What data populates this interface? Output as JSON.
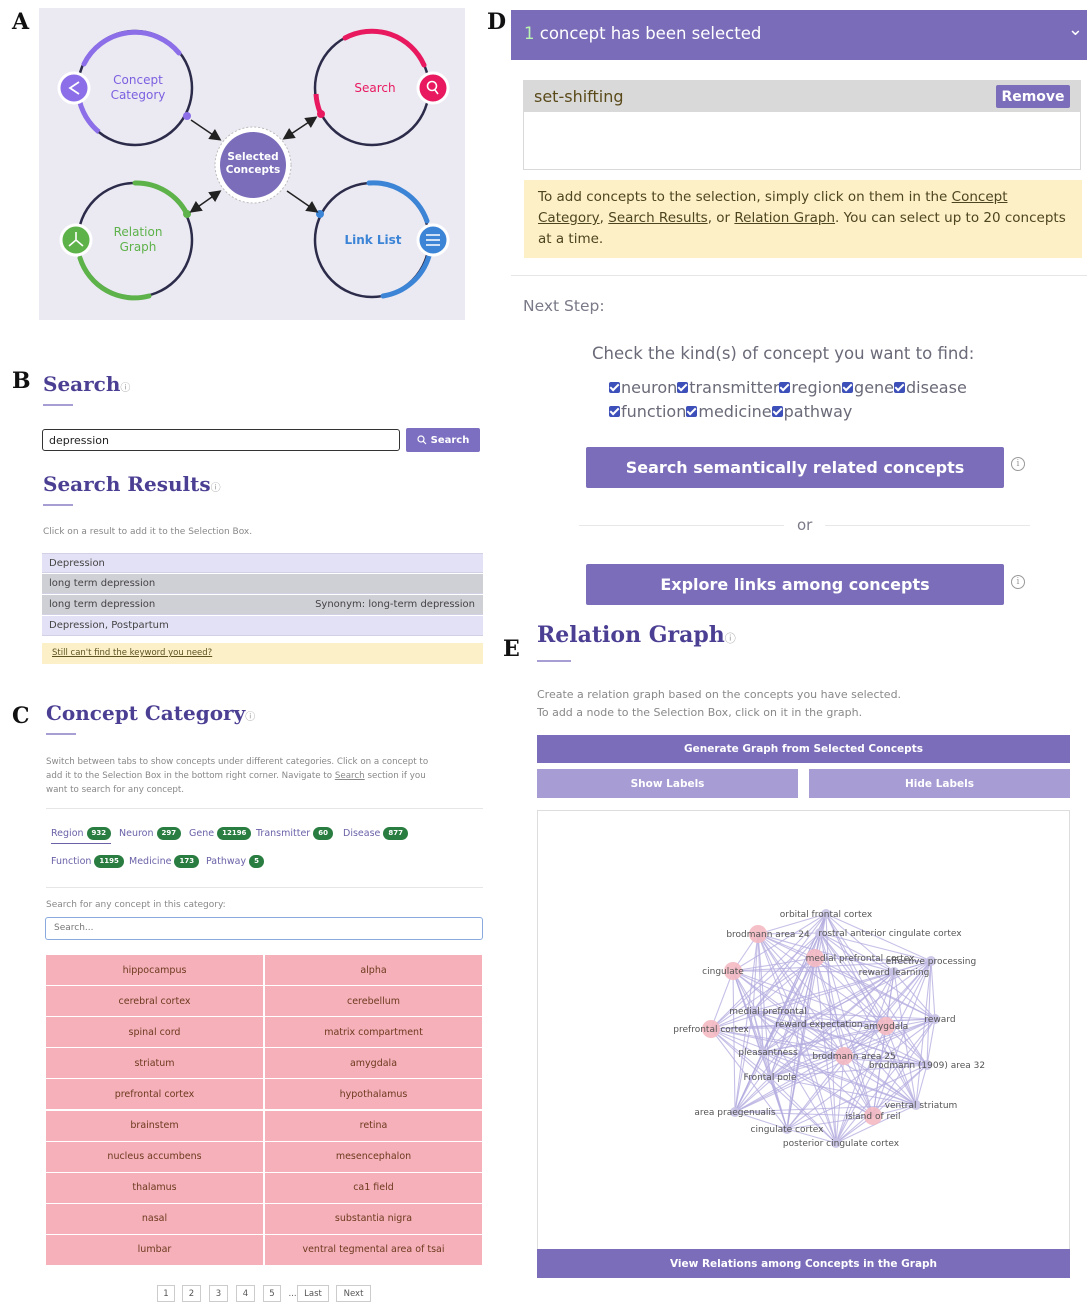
{
  "panel_labels": {
    "a": "A",
    "b": "B",
    "c": "C",
    "d": "D",
    "e": "E"
  },
  "panel_a": {
    "concept_category": "Concept\nCategory",
    "search": "Search",
    "selected_concepts": "Selected\nConcepts",
    "relation_graph": "Relation\nGraph",
    "link_list": "Link List",
    "colors": {
      "purple": "#8b6ee8",
      "red": "#e8195f",
      "green": "#5eb24a",
      "blue": "#3c84d6",
      "dark": "#2c2c4a"
    }
  },
  "panel_b": {
    "title": "Search",
    "info": "ⓘ",
    "search_value": "depression",
    "search_button": "Search",
    "results_title": "Search Results",
    "results_hint": "Click on a result to add it to the Selection Box.",
    "results": [
      {
        "label": "Depression",
        "synonym": "",
        "bg": "#e3e1f5"
      },
      {
        "label": "long term depression",
        "synonym": "",
        "bg": "#cfcfd6"
      },
      {
        "label": "long term depression",
        "synonym": "Synonym: long-term depression",
        "bg": "#cfcfd6"
      },
      {
        "label": "Depression, Postpartum",
        "synonym": "",
        "bg": "#e3e1f5"
      }
    ],
    "not_found": "Still can't find the keyword you need?"
  },
  "panel_c": {
    "title": "Concept Category",
    "info": "ⓘ",
    "desc_line1": "Switch between tabs to show concepts under different categories. Click on a concept to",
    "desc_line2_pre": "add it to the Selection Box in the bottom right corner. Navigate to ",
    "desc_line2_link": "Search",
    "desc_line2_post": " section if you",
    "desc_line3": "want to search for any concept.",
    "tabs_row1": [
      {
        "label": "Region",
        "count": "932"
      },
      {
        "label": "Neuron",
        "count": "297"
      },
      {
        "label": "Gene",
        "count": "12196"
      },
      {
        "label": "Transmitter",
        "count": "60"
      },
      {
        "label": "Disease",
        "count": "877"
      }
    ],
    "tabs_row2": [
      {
        "label": "Function",
        "count": "1195"
      },
      {
        "label": "Medicine",
        "count": "173"
      },
      {
        "label": "Pathway",
        "count": "5"
      }
    ],
    "search_label": "Search for any concept in this category:",
    "search_placeholder": "Search...",
    "grid_left": [
      "hippocampus",
      "cerebral cortex",
      "spinal cord",
      "striatum",
      "prefrontal cortex",
      "brainstem",
      "nucleus accumbens",
      "thalamus",
      "nasal",
      "lumbar"
    ],
    "grid_right": [
      "alpha",
      "cerebellum",
      "matrix compartment",
      "amygdala",
      "hypothalamus",
      "retina",
      "mesencephalon",
      "ca1 field",
      "substantia nigra",
      "ventral tegmental area of tsai"
    ],
    "pages": [
      "1",
      "2",
      "3",
      "4",
      "5",
      "...",
      "Last",
      "Next"
    ]
  },
  "panel_d": {
    "header_count": "1",
    "header_text": " concept has been selected",
    "chevron": "⌄",
    "selected_item": "set-shifting",
    "remove": "Remove",
    "note_1": "To add concepts to the selection, simply click on them in the ",
    "note_link1": "Concept Category",
    "note_2": ", ",
    "note_link2": "Search Results",
    "note_3": ", or ",
    "note_link3": "Relation Graph",
    "note_4": ". You can select up to 20 concepts at a time.",
    "next_step": "Next Step:",
    "check_title": "Check the kind(s) of concept you want to find:",
    "kinds_row1": [
      "neuron",
      "transmitter",
      "region",
      "gene",
      "disease"
    ],
    "kinds_row2": [
      "function",
      "medicine",
      "pathway"
    ],
    "btn_search": "Search semantically related concepts",
    "or": "or",
    "btn_explore": "Explore links among concepts",
    "info": "i"
  },
  "panel_e": {
    "title": "Relation Graph",
    "info": "ⓘ",
    "desc1": "Create a relation graph based on the concepts you have selected.",
    "desc2": "To add a node to the Selection Box, click on it in the graph.",
    "btn_generate": "Generate Graph from Selected Concepts",
    "btn_show": "Show Labels",
    "btn_hide": "Hide Labels",
    "btn_view": "View Relations among Concepts in the Graph",
    "nodes": [
      "orbital frontal cortex",
      "brodmann area 24",
      "rostral anterior cingulate cortex",
      "medial prefrontal cortex",
      "effective processing",
      "cingulate",
      "reward learning",
      "medial prefrontal",
      "reward",
      "prefrontal cortex",
      "reward expectation",
      "amygdala",
      "pleasantness",
      "brodmann area 25",
      "brodmann (1909) area 32",
      "Frontal pole",
      "ventral striatum",
      "area praegenualis",
      "island of reil",
      "cingulate cortex",
      "posterior cingulate cortex"
    ]
  }
}
